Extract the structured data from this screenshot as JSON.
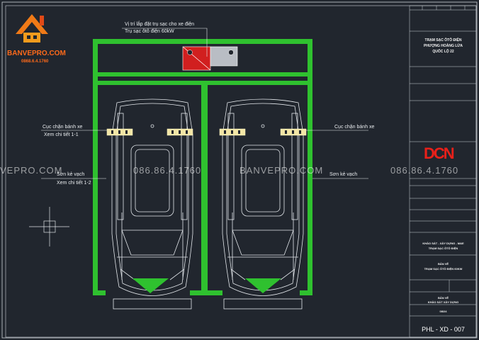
{
  "brand": {
    "name": "BANVEPRO.COM",
    "phone": "0868.6.4.1760"
  },
  "watermark": {
    "site": "BANVEPRO.COM",
    "site_left": "VEPRO.COM",
    "phone": "086.86.4.1760"
  },
  "annotations": {
    "charger_position": "Vị trí lắp đặt trụ sạc cho xe điện",
    "charger_power": "Trụ sạc ôtô điện 60kW",
    "wheel_stop_left": "Cục chặn bánh xe",
    "wheel_stop_detail": "Xem chi tiết 1-1",
    "wheel_stop_right": "Cục chặn bánh xe",
    "paint_line_left": "Sơn kẻ vạch",
    "paint_line_detail": "Xem chi tiết 1-2",
    "paint_line_right": "Sơn kẻ vạch"
  },
  "colors": {
    "green": "#2fc12f",
    "red": "#d11f1f",
    "background": "#21262e",
    "brand_orange": "#ff6a1a"
  },
  "title_block": {
    "project_title": [
      "TRẠM SẠC ÔTÔ ĐIỆN",
      "PHƯỢNG HOÀNG LỬA",
      "QUỐC LỘ 22"
    ],
    "sheet_title": "BẢN VẼ",
    "sheet_subtitle": "TRẠM SẠC ÔTÔ ĐIỆN 60KW",
    "drawing_type": "BẢN VẼ",
    "drawing_subtype": "KHẢO SÁT XÂY DỰNG",
    "category": "KHẢO SÁT - XÂY DỰNG - M&E",
    "category_sub": "TRẠM SẠC ÔTÔ ĐIỆN",
    "date": "08/24",
    "logo": "DCN",
    "sheet_code": "PHL - XD - 007"
  },
  "icons": [
    "house-logo-icon",
    "ucs-crosshair-icon",
    "ev-charger-icon"
  ]
}
